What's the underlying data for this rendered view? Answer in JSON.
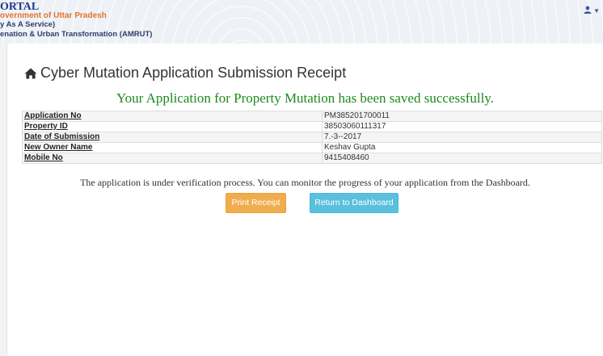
{
  "header": {
    "brand_line1": "ORTAL",
    "brand_line2": "overnment of Uttar Pradesh",
    "brand_line3": "y As A Service)",
    "brand_line4": "enation & Urban Transformation (AMRUT)",
    "user_icon": "user-icon",
    "caret_icon": "caret-down-icon"
  },
  "page": {
    "title": "Cyber Mutation Application Submission Receipt",
    "title_icon": "home-icon",
    "success_message": "Your Application for Property Mutation has been saved successfully.",
    "details": [
      {
        "label": "Application No",
        "value": "PM385201700011"
      },
      {
        "label": "Property ID",
        "value": "38503060111317"
      },
      {
        "label": "Date of Submission",
        "value": "7.-3--2017"
      },
      {
        "label": "New Owner Name",
        "value": "Keshav Gupta"
      },
      {
        "label": "Mobile No",
        "value": "9415408460"
      }
    ],
    "note": "The application is under verification process. You can monitor the progress of your application from the Dashboard."
  },
  "buttons": {
    "print_label": "Print Receipt",
    "dashboard_label": "Return to Dashboard"
  },
  "colors": {
    "success_green": "#1c8a1c",
    "print_orange": "#f0ad4e",
    "dashboard_blue": "#5bc0de",
    "brand_blue": "#1d3a8a",
    "brand_orange": "#e3742b"
  }
}
